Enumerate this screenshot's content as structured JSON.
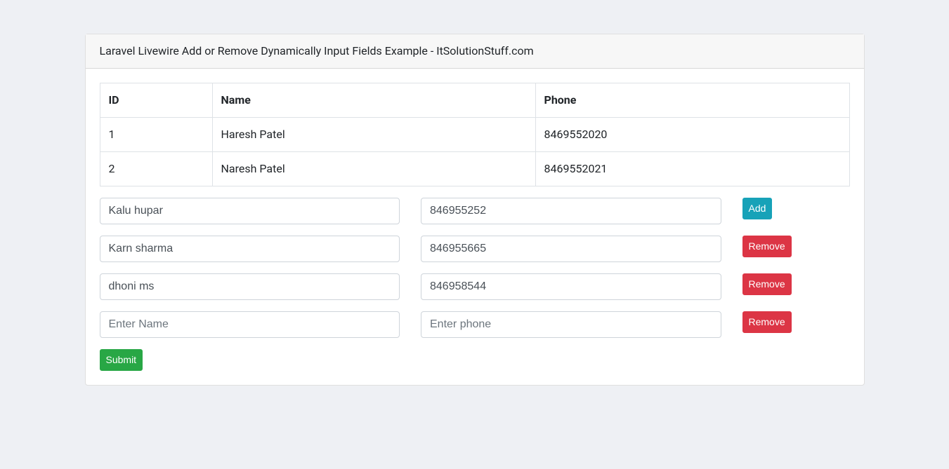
{
  "header": {
    "title": "Laravel Livewire Add or Remove Dynamically Input Fields Example - ItSolutionStuff.com"
  },
  "table": {
    "headers": {
      "id": "ID",
      "name": "Name",
      "phone": "Phone"
    },
    "rows": [
      {
        "id": "1",
        "name": "Haresh Patel",
        "phone": "8469552020"
      },
      {
        "id": "2",
        "name": "Naresh Patel",
        "phone": "8469552021"
      }
    ]
  },
  "inputs": [
    {
      "name": "Kalu hupar",
      "phone": "846955252",
      "button": "Add",
      "buttonType": "add"
    },
    {
      "name": "Karn sharma",
      "phone": "846955665",
      "button": "Remove",
      "buttonType": "remove"
    },
    {
      "name": "dhoni ms",
      "phone": "846958544",
      "button": "Remove",
      "buttonType": "remove"
    },
    {
      "name": "",
      "phone": "",
      "button": "Remove",
      "buttonType": "remove"
    }
  ],
  "placeholders": {
    "name": "Enter Name",
    "phone": "Enter phone"
  },
  "buttons": {
    "add": "Add",
    "remove": "Remove",
    "submit": "Submit"
  }
}
